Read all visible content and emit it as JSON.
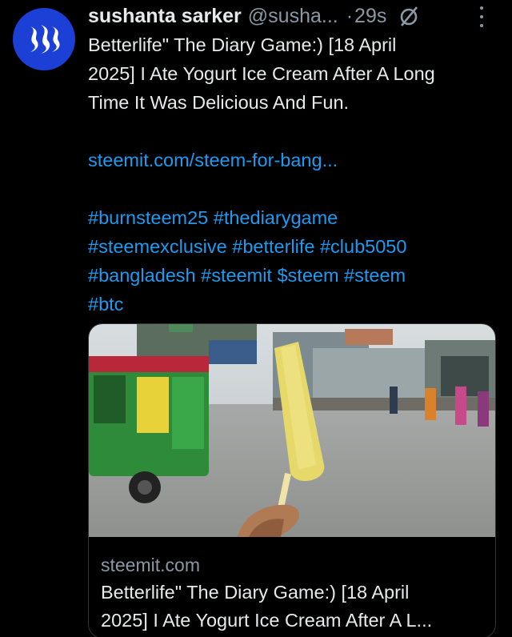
{
  "post": {
    "author_name": "sushanta sarker",
    "handle": "@susha...",
    "separator": "·",
    "time": "29s",
    "body_lines": [
      "Betterlife\" The Diary Game:) [18 April",
      "2025] I Ate Yogurt Ice Cream After A Long",
      "Time It Was Delicious And Fun."
    ],
    "link_text": "steemit.com/steem-for-bang...",
    "hashtag_lines": [
      "#burnsteem25 #thediarygame",
      "#steemexclusive #betterlife #club5050",
      "#bangladesh #steemit $steem #steem",
      "#btc"
    ]
  },
  "card": {
    "domain": "steemit.com",
    "title_lines": [
      "Betterlife\" The Diary Game:) [18 April",
      "2025] I Ate Yogurt Ice Cream After A L..."
    ]
  },
  "icons": {
    "avatar": "steem-logo-icon",
    "status": "null-circle-icon",
    "menu": "more-vertical-icon"
  },
  "colors": {
    "background": "#000000",
    "text": "#e7e9ea",
    "muted": "#8b98a5",
    "link": "#1d9bf0",
    "avatar_bg": "#1c3fd6"
  }
}
